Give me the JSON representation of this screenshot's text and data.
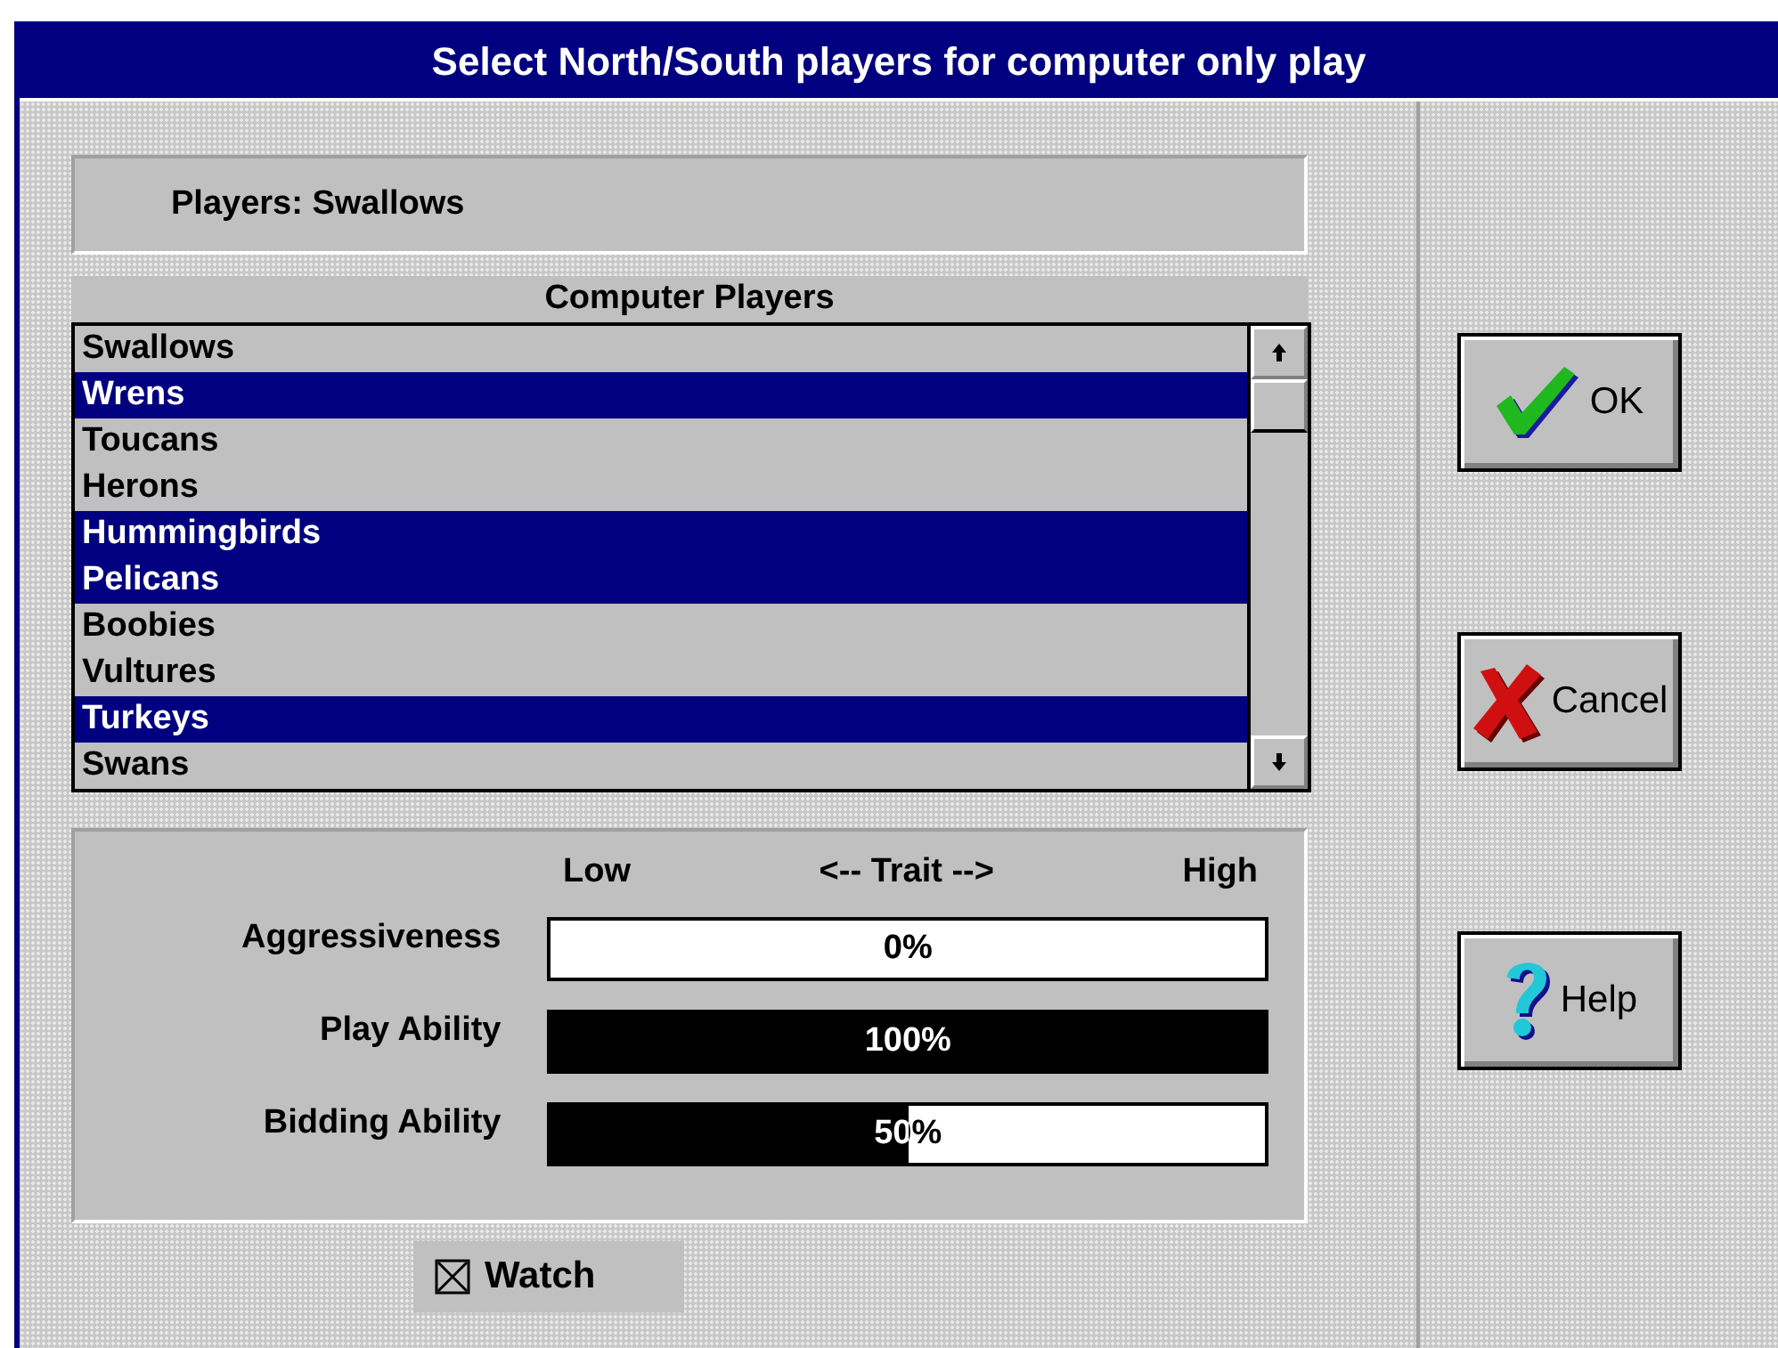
{
  "window": {
    "title": "Select North/South players for computer only play"
  },
  "players_label": "Players: Swallows",
  "list": {
    "title": "Computer Players",
    "items": [
      {
        "name": "Swallows",
        "selected": false
      },
      {
        "name": "Wrens",
        "selected": true
      },
      {
        "name": "Toucans",
        "selected": false
      },
      {
        "name": "Herons",
        "selected": false
      },
      {
        "name": "Hummingbirds",
        "selected": true
      },
      {
        "name": "Pelicans",
        "selected": true
      },
      {
        "name": "Boobies",
        "selected": false
      },
      {
        "name": "Vultures",
        "selected": false
      },
      {
        "name": "Turkeys",
        "selected": true
      },
      {
        "name": "Swans",
        "selected": false
      }
    ]
  },
  "traits": {
    "low": "Low",
    "middle": "<-- Trait -->",
    "high": "High",
    "sliders": [
      {
        "label": "Aggressiveness",
        "reading": "0%"
      },
      {
        "label": "Play Ability",
        "level": 1,
        "reading": "100%"
      },
      {
        "label": "Bidding Ability",
        "level": 0.5,
        "reading": "50%"
      }
    ]
  },
  "watch": {
    "label": "Watch",
    "checked": true
  },
  "buttons": [
    {
      "kind": "ok",
      "label": "OK"
    },
    {
      "kind": "cancel",
      "label": "Cancel"
    },
    {
      "kind": "help",
      "label": "Help"
    }
  ]
}
